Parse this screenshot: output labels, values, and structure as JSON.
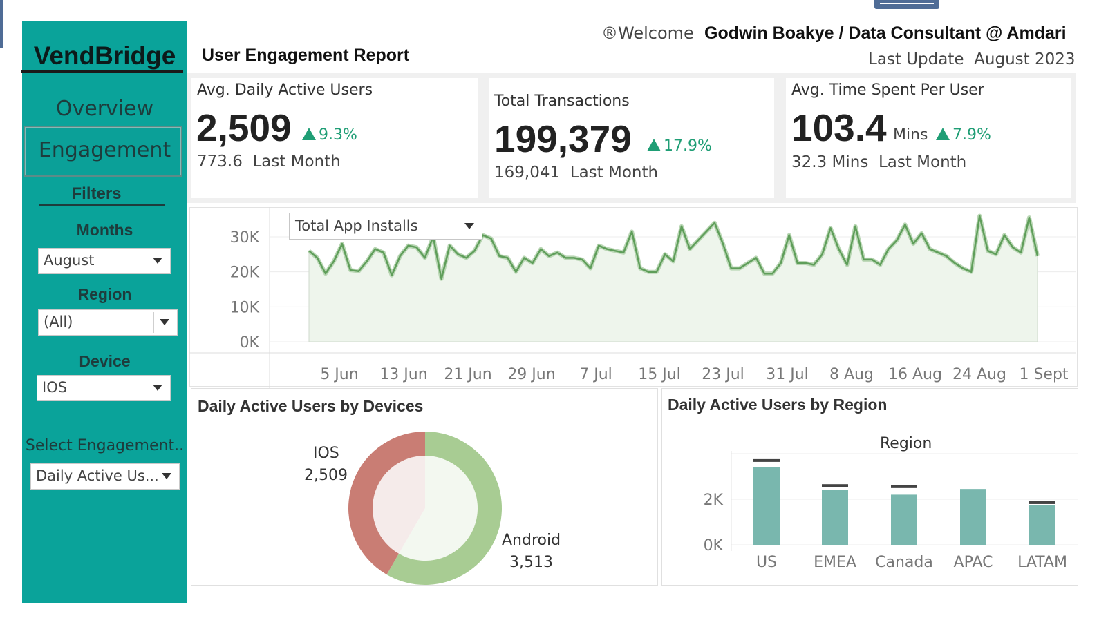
{
  "brand": "VendBridge",
  "nav": {
    "overview": "Overview",
    "engagement": "Engagement"
  },
  "filters": {
    "title": "Filters",
    "months": {
      "label": "Months",
      "value": "August"
    },
    "region": {
      "label": "Region",
      "value": "(All)"
    },
    "device": {
      "label": "Device",
      "value": "IOS"
    },
    "engagement": {
      "label": "Select Engagement..",
      "value": "Daily Active Us..."
    }
  },
  "header": {
    "title": "User Engagement Report",
    "welcome_prefix": "®Welcome",
    "welcome_user": "Godwin Boakye / Data Consultant @ Amdari",
    "last_update_label": "Last Update",
    "last_update_value": "August 2023"
  },
  "kpis": [
    {
      "label": "Avg. Daily  Active Users",
      "value": "2,509",
      "unit": "",
      "delta": "9.3%",
      "prev_value": "773.6",
      "prev_label": "Last Month"
    },
    {
      "label": "Total Transactions",
      "value": "199,379",
      "unit": "",
      "delta": "17.9%",
      "prev_value": "169,041",
      "prev_label": "Last Month"
    },
    {
      "label": "Avg. Time Spent Per User",
      "value": "103.4",
      "unit": "Mins",
      "delta": "7.9%",
      "prev_value": "32.3 Mins",
      "prev_label": "Last Month"
    }
  ],
  "colors": {
    "sidebar": "#0aa39a",
    "positive": "#1f9e75",
    "line": "#5f9e5a",
    "android": "#a8cc93",
    "ios": "#c97d74",
    "bar": "#79b7ae"
  },
  "chart_data": [
    {
      "type": "area",
      "selector": "Total App Installs",
      "yticks": [
        "0K",
        "10K",
        "20K",
        "30K"
      ],
      "ylim": [
        0,
        32000
      ],
      "xticks": [
        "5 Jun",
        "13 Jun",
        "21 Jun",
        "29 Jun",
        "7 Jul",
        "15 Jul",
        "23 Jul",
        "31 Jul",
        "8 Aug",
        "16 Aug",
        "24 Aug",
        "1 Sept"
      ],
      "x_start": "2023-06-01",
      "series": [
        {
          "values": [
            26000,
            24000,
            19500,
            23000,
            28000,
            20500,
            20200,
            23000,
            26500,
            25500,
            19000,
            24500,
            27500,
            27000,
            24000,
            30000,
            18000,
            27500,
            25000,
            24000,
            26000,
            30500,
            29500,
            24500,
            24000,
            20000,
            24000,
            22500,
            26500,
            24500,
            25500,
            24000,
            24000,
            23500,
            21000,
            27500,
            26500,
            26000,
            25500,
            31500,
            21000,
            20000,
            20000,
            25000,
            23000,
            33000,
            26500,
            29000,
            31500,
            34000,
            28000,
            21000,
            21000,
            22500,
            24000,
            19500,
            19500,
            22500,
            30500,
            22500,
            22500,
            22000,
            25000,
            32500,
            26500,
            22000,
            33000,
            23500,
            23500,
            22000,
            26500,
            29000,
            33500,
            28000,
            31000,
            26500,
            25500,
            24500,
            22500,
            21000,
            20000,
            36000,
            26000,
            25000,
            30500,
            27000,
            25500,
            35500,
            24500
          ]
        }
      ]
    },
    {
      "type": "pie",
      "title": "Daily Active Users by Devices",
      "labels": [
        "IOS",
        "Android"
      ],
      "values": [
        2509,
        3513
      ],
      "value_labels": [
        "2,509",
        "3,513"
      ]
    },
    {
      "type": "bar",
      "title": "Daily Active Users by Region",
      "legend_title": "Region",
      "categories": [
        "US",
        "EMEA",
        "Canada",
        "APAC",
        "LATAM"
      ],
      "values": [
        3400,
        2400,
        2200,
        2450,
        1750
      ],
      "reference": [
        3700,
        2600,
        2550,
        null,
        1850
      ],
      "yticks": [
        "0K",
        "2K"
      ],
      "ylim": [
        0,
        4000
      ]
    }
  ]
}
